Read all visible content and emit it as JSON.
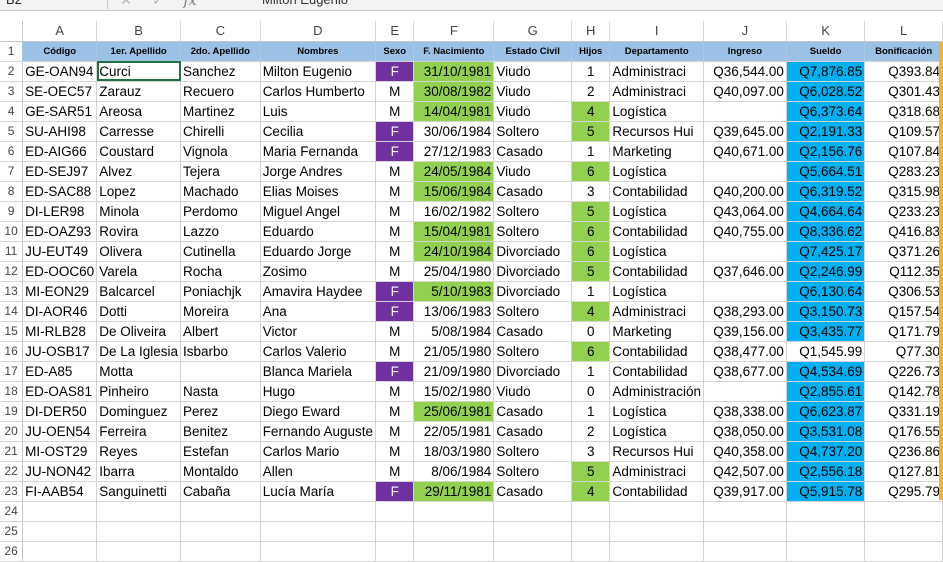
{
  "formula_bar": {
    "name_box": "B2",
    "cancel_icon": "✕",
    "confirm_icon": "✓",
    "fx_label": "fx",
    "content": "Milton Eugenio"
  },
  "column_letters": [
    "A",
    "B",
    "C",
    "D",
    "E",
    "F",
    "G",
    "H",
    "I",
    "J",
    "K",
    "L"
  ],
  "header_row": {
    "row_num": "1",
    "labels": [
      "Código",
      "1er. Apellido",
      "2do. Apellido",
      "Nombres",
      "Sexo",
      "F. Nacimiento",
      "Estado Civil",
      "Hijos",
      "Departamento",
      "Ingreso",
      "Sueldo",
      "Bonificación"
    ]
  },
  "rows": [
    {
      "num": "2",
      "cells": [
        "GE-OAN94",
        "Curci",
        "Sanchez",
        "Milton Eugenio",
        "F",
        "31/10/1981",
        "Viudo",
        "1",
        "Administraci",
        "Q36,544.00",
        "Q7,876.85",
        "Q393.84"
      ]
    },
    {
      "num": "3",
      "cells": [
        "SE-OEC57",
        "Zarauz",
        "Recuero",
        "Carlos Humberto",
        "M",
        "30/08/1982",
        "Viudo",
        "2",
        "Administraci",
        "Q40,097.00",
        "Q6,028.52",
        "Q301.43"
      ]
    },
    {
      "num": "4",
      "cells": [
        "GE-SAR51",
        "Areosa",
        "Martinez",
        "Luis",
        "M",
        "14/04/1981",
        "Viudo",
        "4",
        "Logística",
        "",
        "Q6,373.64",
        "Q318.68"
      ]
    },
    {
      "num": "5",
      "cells": [
        "SU-AHI98",
        "Carresse",
        "Chirelli",
        "Cecilia",
        "F",
        "30/06/1984",
        "Soltero",
        "5",
        "Recursos Hui",
        "Q39,645.00",
        "Q2,191.33",
        "Q109.57"
      ]
    },
    {
      "num": "6",
      "cells": [
        "ED-AIG66",
        "Coustard",
        "Vignola",
        "Maria Fernanda",
        "F",
        "27/12/1983",
        "Casado",
        "1",
        "Marketing",
        "Q40,671.00",
        "Q2,156.76",
        "Q107.84"
      ]
    },
    {
      "num": "7",
      "cells": [
        "ED-SEJ97",
        "Alvez",
        "Tejera",
        "Jorge Andres",
        "M",
        "24/05/1984",
        "Viudo",
        "6",
        "Logística",
        "",
        "Q5,664.51",
        "Q283.23"
      ]
    },
    {
      "num": "8",
      "cells": [
        "ED-SAC88",
        "Lopez",
        "Machado",
        "Elias Moises",
        "M",
        "15/06/1984",
        "Casado",
        "3",
        "Contabilidad",
        "Q40,200.00",
        "Q6,319.52",
        "Q315.98"
      ]
    },
    {
      "num": "9",
      "cells": [
        "DI-LER98",
        "Minola",
        "Perdomo",
        "Miguel Angel",
        "M",
        "16/02/1982",
        "Soltero",
        "5",
        "Logística",
        "Q43,064.00",
        "Q4,664.64",
        "Q233.23"
      ]
    },
    {
      "num": "10",
      "cells": [
        "ED-OAZ93",
        "Rovira",
        "Lazzo",
        "Eduardo",
        "M",
        "15/04/1981",
        "Soltero",
        "6",
        "Contabilidad",
        "Q40,755.00",
        "Q8,336.62",
        "Q416.83"
      ]
    },
    {
      "num": "11",
      "cells": [
        "JU-EUT49",
        "Olivera",
        "Cutinella",
        "Eduardo Jorge",
        "M",
        "24/10/1984",
        "Divorciado",
        "6",
        "Logística",
        "",
        "Q7,425.17",
        "Q371.26"
      ]
    },
    {
      "num": "12",
      "cells": [
        "ED-OOC60",
        "Varela",
        "Rocha",
        "Zosimo",
        "M",
        "25/04/1980",
        "Divorciado",
        "5",
        "Contabilidad",
        "Q37,646.00",
        "Q2,246.99",
        "Q112.35"
      ]
    },
    {
      "num": "13",
      "cells": [
        "MI-EON29",
        "Balcarcel",
        "Poniachjk",
        "Amavira Haydee",
        "F",
        "5/10/1983",
        "Divorciado",
        "1",
        "Logística",
        "",
        "Q6,130.64",
        "Q306.53"
      ]
    },
    {
      "num": "14",
      "cells": [
        "DI-AOR46",
        "Dotti",
        "Moreira",
        "Ana",
        "F",
        "13/06/1983",
        "Soltero",
        "4",
        "Administraci",
        "Q38,293.00",
        "Q3,150.73",
        "Q157.54"
      ]
    },
    {
      "num": "15",
      "cells": [
        "MI-RLB28",
        "De Oliveira",
        "Albert",
        "Victor",
        "M",
        "5/08/1984",
        "Casado",
        "0",
        "Marketing",
        "Q39,156.00",
        "Q3,435.77",
        "Q171.79"
      ]
    },
    {
      "num": "16",
      "cells": [
        "JU-OSB17",
        "De La Iglesia",
        "Isbarbo",
        "Carlos Valerio",
        "M",
        "21/05/1980",
        "Soltero",
        "6",
        "Contabilidad",
        "Q38,477.00",
        "Q1,545.99",
        "Q77.30"
      ]
    },
    {
      "num": "17",
      "cells": [
        "ED-A85",
        "Motta",
        "",
        "Blanca Mariela",
        "F",
        "21/09/1980",
        "Divorciado",
        "1",
        "Contabilidad",
        "Q38,677.00",
        "Q4,534.69",
        "Q226.73"
      ]
    },
    {
      "num": "18",
      "cells": [
        "ED-OAS81",
        "Pinheiro",
        "Nasta",
        "Hugo",
        "M",
        "15/02/1980",
        "Viudo",
        "0",
        "Administración",
        "",
        "Q2,855.61",
        "Q142.78"
      ]
    },
    {
      "num": "19",
      "cells": [
        "DI-DER50",
        "Dominguez",
        "Perez",
        "Diego Eward",
        "M",
        "25/06/1981",
        "Casado",
        "1",
        "Logística",
        "Q38,338.00",
        "Q6,623.87",
        "Q331.19"
      ]
    },
    {
      "num": "20",
      "cells": [
        "JU-OEN54",
        "Ferreira",
        "Benitez",
        "Fernando Auguste",
        "M",
        "22/05/1981",
        "Casado",
        "2",
        "Logística",
        "Q38,050.00",
        "Q3,531.08",
        "Q176.55"
      ]
    },
    {
      "num": "21",
      "cells": [
        "MI-OST29",
        "Reyes",
        "Estefan",
        "Carlos Mario",
        "M",
        "18/03/1980",
        "Soltero",
        "3",
        "Recursos Hui",
        "Q40,358.00",
        "Q4,737.20",
        "Q236.86"
      ]
    },
    {
      "num": "22",
      "cells": [
        "JU-NON42",
        "Ibarra",
        "Montaldo",
        "Allen",
        "M",
        "8/06/1984",
        "Soltero",
        "5",
        "Administraci",
        "Q42,507.00",
        "Q2,556.18",
        "Q127.81"
      ]
    },
    {
      "num": "23",
      "cells": [
        "FI-AAB54",
        "Sanguinetti",
        "Cabaña",
        "Lucía María",
        "F",
        "29/11/1981",
        "Casado",
        "4",
        "Contabilidad",
        "Q39,917.00",
        "Q5,915.78",
        "Q295.79"
      ]
    }
  ],
  "empty_rows": [
    "24",
    "25",
    "26"
  ],
  "styles": {
    "green_dates": [
      0,
      1,
      2,
      5,
      6,
      8,
      9,
      11,
      17,
      21
    ],
    "green_hijos": [
      2,
      3,
      5,
      7,
      8,
      9,
      10,
      12,
      14,
      20,
      21
    ],
    "blue_sueldo": [
      0,
      1,
      2,
      3,
      4,
      5,
      6,
      7,
      8,
      9,
      10,
      11,
      12,
      13,
      15,
      16,
      17,
      18,
      19,
      20,
      21
    ],
    "colors": {
      "header": "#9bc2e6",
      "female": "#7030a0",
      "green": "#92d050",
      "blue": "#00b0f0"
    }
  }
}
